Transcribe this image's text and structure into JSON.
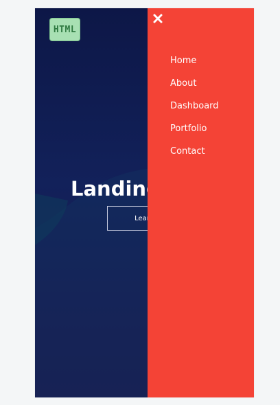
{
  "logo": {
    "text": "HTML"
  },
  "hero": {
    "title": "Landing",
    "button_label": "Learn M"
  },
  "side_nav": {
    "items": [
      {
        "label": "Home"
      },
      {
        "label": "About"
      },
      {
        "label": "Dashboard"
      },
      {
        "label": "Portfolio"
      },
      {
        "label": "Contact"
      }
    ]
  },
  "icons": {
    "close": "close-icon"
  },
  "colors": {
    "nav_bg": "#f44336",
    "hero_bg_top": "#0d1747",
    "hero_bg_bottom": "#1d1248",
    "logo_bg": "#a8e0b3"
  }
}
